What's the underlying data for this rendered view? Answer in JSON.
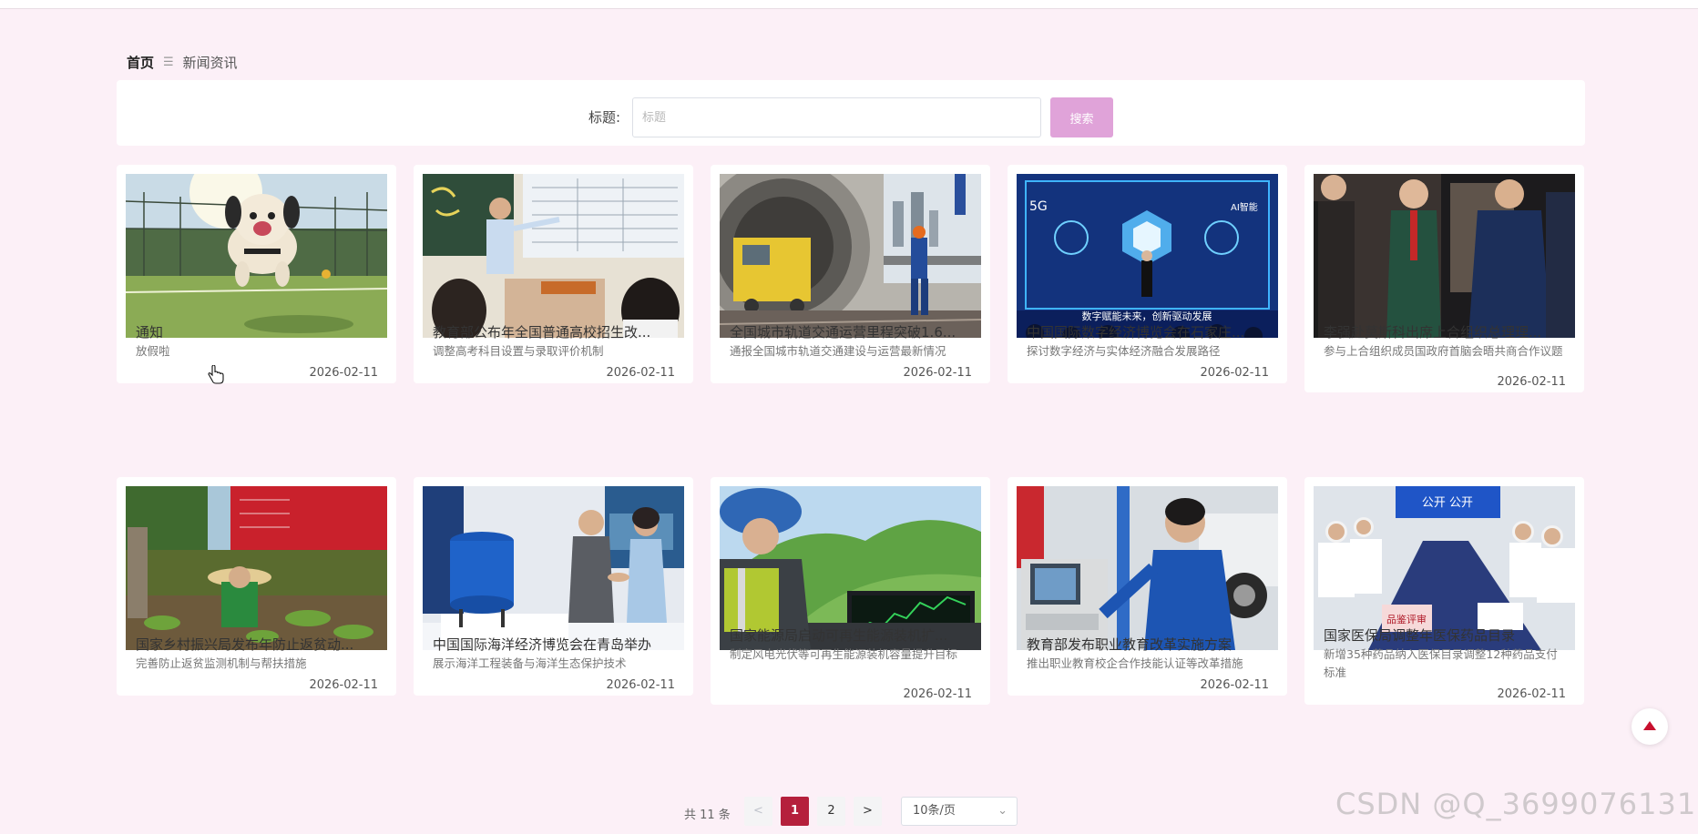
{
  "breadcrumb": {
    "home": "首页",
    "separator": "☰",
    "current": "新闻资讯"
  },
  "search": {
    "label": "标题:",
    "placeholder": "标题",
    "value": "",
    "button": "搜索"
  },
  "cards": [
    {
      "title": "通知",
      "desc": "放假啦",
      "date": "2026-02-11",
      "image": "dog-running-on-tennis-court"
    },
    {
      "title": "教育部公布年全国普通高校招生改...",
      "desc": "调整高考科目设置与录取评价机制",
      "date": "2026-02-11",
      "image": "teacher-at-classroom-screen"
    },
    {
      "title": "全国城市轨道交通运营里程突破1.6...",
      "desc": "通报全国城市轨道交通建设与运营最新情况",
      "date": "2026-02-11",
      "image": "rail-tunnel-worker"
    },
    {
      "title": "中国国际数字经济博览会在石家庄...",
      "desc": "探讨数字经济与实体经济融合发展路径",
      "date": "2026-02-11",
      "image": "digital-expo-stage"
    },
    {
      "title": "李强赴莫斯科出席上合组织总理理...",
      "desc": "参与上合组织成员国政府首脑会晤共商合作议题",
      "date": "2026-02-11",
      "image": "officials-walking"
    },
    {
      "title": "国家乡村振兴局发布年防止返贫动...",
      "desc": "完善防止返贫监测机制与帮扶措施",
      "date": "2026-02-11",
      "image": "farmer-in-field"
    },
    {
      "title": "中国国际海洋经济博览会在青岛举办",
      "desc": "展示海洋工程装备与海洋生态保护技术",
      "date": "2026-02-11",
      "image": "marine-expo-handshake"
    },
    {
      "title": "国家能源局启动可再生能源装机扩...",
      "desc": "制定风电光伏等可再生能源装机容量提升目标",
      "date": "2026-02-11",
      "image": "engineer-with-monitor"
    },
    {
      "title": "教育部发布职业教育改革实施方案",
      "desc": "推出职业教育校企合作技能认证等改革措施",
      "date": "2026-02-11",
      "image": "vocational-workshop"
    },
    {
      "title": "国家医保局调整年医保药品目录",
      "desc": "新增35种药品纳入医保目录调整12种药品支付标准",
      "date": "2026-02-11",
      "image": "medical-review-meeting"
    }
  ],
  "image_texts": {
    "card4_sign": "公开  公开",
    "card9_sign": "品鉴评审",
    "card3_slogan": "数字赋能未来，创新驱动发展",
    "card3_5g": "5G",
    "card3_ai": "AI智能"
  },
  "pagination": {
    "total": "共 11 条",
    "prev": "<",
    "pages": [
      "1",
      "2"
    ],
    "active_page": "1",
    "next": ">",
    "page_size": "10条/页"
  },
  "watermark": "CSDN @Q_3699076131",
  "colors": {
    "accent": "#b5203c",
    "search_button": "#e0a3d9",
    "background": "#fcf0f7"
  }
}
